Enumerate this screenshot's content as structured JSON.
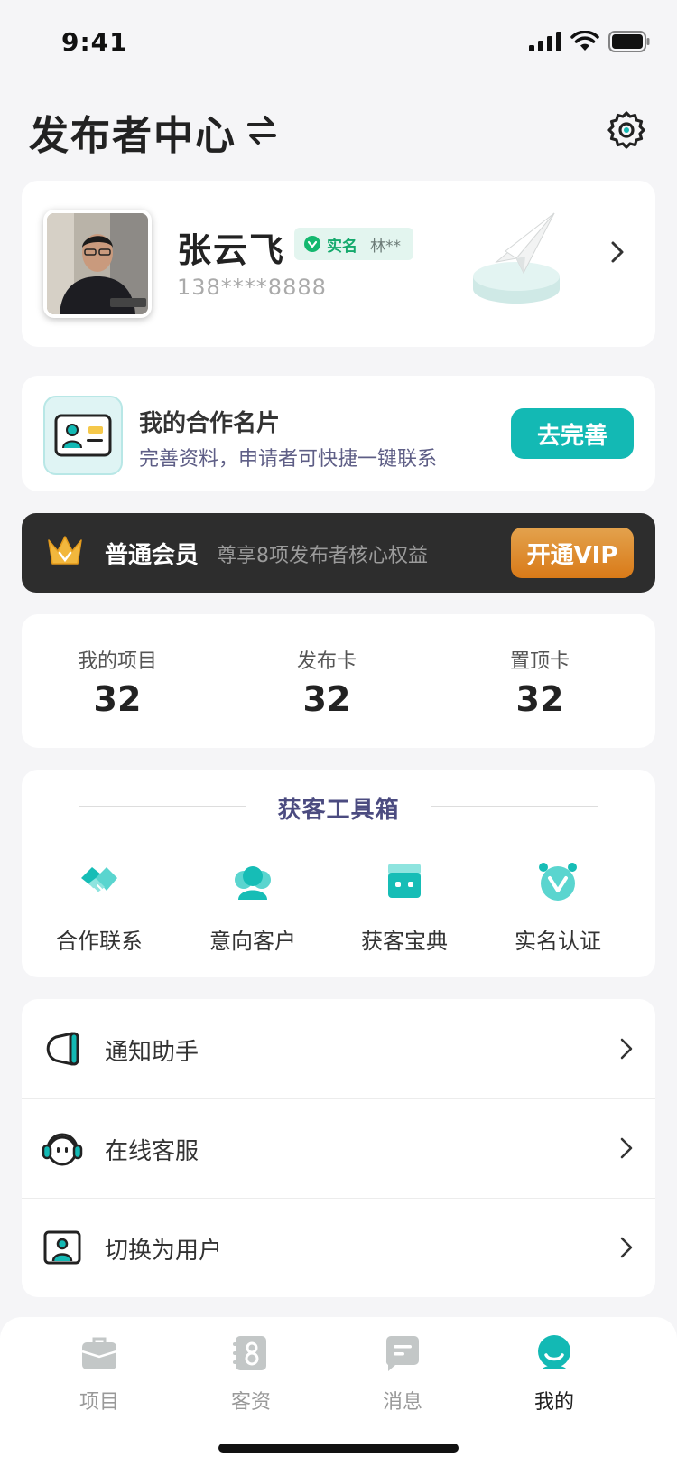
{
  "status_bar": {
    "time": "9:41"
  },
  "header": {
    "title": "发布者中心"
  },
  "profile": {
    "name": "张云飞",
    "verify_label": "实名",
    "verify_name": "林**",
    "phone": "138****8888"
  },
  "business_card": {
    "title": "我的合作名片",
    "subtitle": "完善资料，申请者可快捷一键联系",
    "button": "去完善"
  },
  "vip": {
    "level": "普通会员",
    "desc": "尊享8项发布者核心权益",
    "button": "开通VIP"
  },
  "stats": [
    {
      "label": "我的项目",
      "value": "32"
    },
    {
      "label": "发布卡",
      "value": "32"
    },
    {
      "label": "置顶卡",
      "value": "32"
    }
  ],
  "toolbox": {
    "title": "获客工具箱",
    "items": [
      {
        "label": "合作联系",
        "icon": "handshake-icon"
      },
      {
        "label": "意向客户",
        "icon": "customers-icon"
      },
      {
        "label": "获客宝典",
        "icon": "store-icon"
      },
      {
        "label": "实名认证",
        "icon": "verified-badge-icon"
      }
    ]
  },
  "menu": [
    {
      "label": "通知助手",
      "icon": "speaker-icon"
    },
    {
      "label": "在线客服",
      "icon": "headset-icon"
    },
    {
      "label": "切换为用户",
      "icon": "user-switch-icon"
    }
  ],
  "tabbar": [
    {
      "label": "项目",
      "icon": "briefcase-icon",
      "active": false
    },
    {
      "label": "客资",
      "icon": "contacts-icon",
      "active": false
    },
    {
      "label": "消息",
      "icon": "message-icon",
      "active": false
    },
    {
      "label": "我的",
      "icon": "profile-icon",
      "active": true
    }
  ],
  "colors": {
    "accent": "#13b9b4",
    "vip_orange": "#d97a18",
    "toolbox_title": "#4b4b80",
    "verify_green": "#14a96c"
  }
}
